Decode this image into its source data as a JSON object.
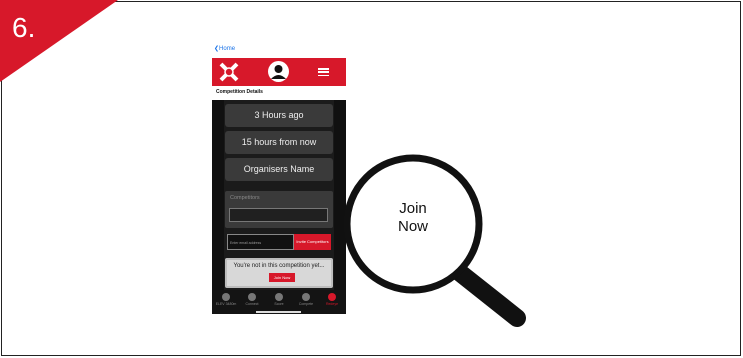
{
  "step": {
    "number": "6."
  },
  "app": {
    "nav_back": "Home",
    "section_title": "Competition Details",
    "cards": [
      "3 Hours ago",
      "15 hours from now",
      "Organisers Name"
    ],
    "competitors_label": "Competitors",
    "email_placeholder": "Enter email address",
    "invite_button": "Invite Competitors",
    "notice_text": "You're not in this competition yet...",
    "join_button": "Join Now",
    "bottom_nav": [
      {
        "label": "ELEV 3480m",
        "icon": "mountain-icon"
      },
      {
        "label": "Connect",
        "icon": "wifi-icon"
      },
      {
        "label": "Score",
        "icon": "score-icon"
      },
      {
        "label": "Compete",
        "icon": "trophy-icon"
      },
      {
        "label": "Redeye",
        "icon": "redeye-icon",
        "active": true
      }
    ]
  },
  "magnifier": {
    "label_line1": "Join",
    "label_line2": "Now"
  },
  "colors": {
    "brand_red": "#d7182a",
    "dark_bg": "#1b1b1b",
    "card": "#3a3a3a"
  }
}
